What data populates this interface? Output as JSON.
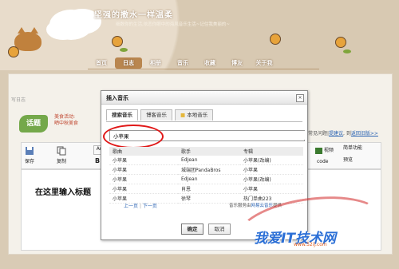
{
  "site": {
    "title": "坚强的撒水一样温柔",
    "subtitle": "细数你的生活,依恋你眼中的海风音乐生活~记住我美丽的~"
  },
  "nav": [
    {
      "label": "首页",
      "active": false
    },
    {
      "label": "日志",
      "active": true
    },
    {
      "label": "相册",
      "active": false
    },
    {
      "label": "音乐",
      "active": false
    },
    {
      "label": "收藏",
      "active": false
    },
    {
      "label": "博友",
      "active": false
    },
    {
      "label": "关于我",
      "active": false
    }
  ],
  "page": {
    "breadcrumb": "写日志",
    "logo_tag": "话题",
    "promo_line1": "美食活动:",
    "promo_line2": "晒中秋美食",
    "right_links": {
      "suggest": "提建议",
      "old": "返回旧版>>",
      "prefix": "常见问题|",
      "mid": ", 到"
    }
  },
  "toolbar": {
    "save": "保存",
    "copy": "复制",
    "bold": "B",
    "font": "Ar",
    "video": "视频",
    "code": "code",
    "simple": "简单功能",
    "preview": "预览"
  },
  "editor": {
    "title_placeholder": "在这里输入标题"
  },
  "dialog": {
    "title": "插入音乐",
    "close": "×",
    "tabs": [
      {
        "label": "搜索音乐",
        "active": true
      },
      {
        "label": "博客音乐",
        "active": false
      },
      {
        "label": "本地音乐",
        "active": false
      }
    ],
    "search_value": "小苹果",
    "columns": [
      "歌曲",
      "歌手",
      "专辑"
    ],
    "rows": [
      [
        "小苹果",
        "EdJean",
        "小苹果(改编)"
      ],
      [
        "小苹果",
        "城端团PandaBros",
        "小苹果"
      ],
      [
        "小苹果",
        "EdJean",
        "小苹果(改编)"
      ],
      [
        "小苹果",
        "肖恩",
        "小苹果"
      ],
      [
        "小苹果",
        "徐琴",
        "热门单曲223"
      ]
    ],
    "pager_prev": "上一页",
    "pager_next": "下一页",
    "provider_prefix": "音乐服务由",
    "provider_name": "网易云音乐",
    "provider_suffix": "提供",
    "ok": "确定",
    "cancel": "取消"
  },
  "watermark": {
    "text": "我爱IT技术网",
    "url": "www.52ij.com"
  },
  "colors": {
    "accent_red": "#e01818",
    "link_blue": "#2a63b3",
    "watermark_blue": "#2b6fd6"
  }
}
